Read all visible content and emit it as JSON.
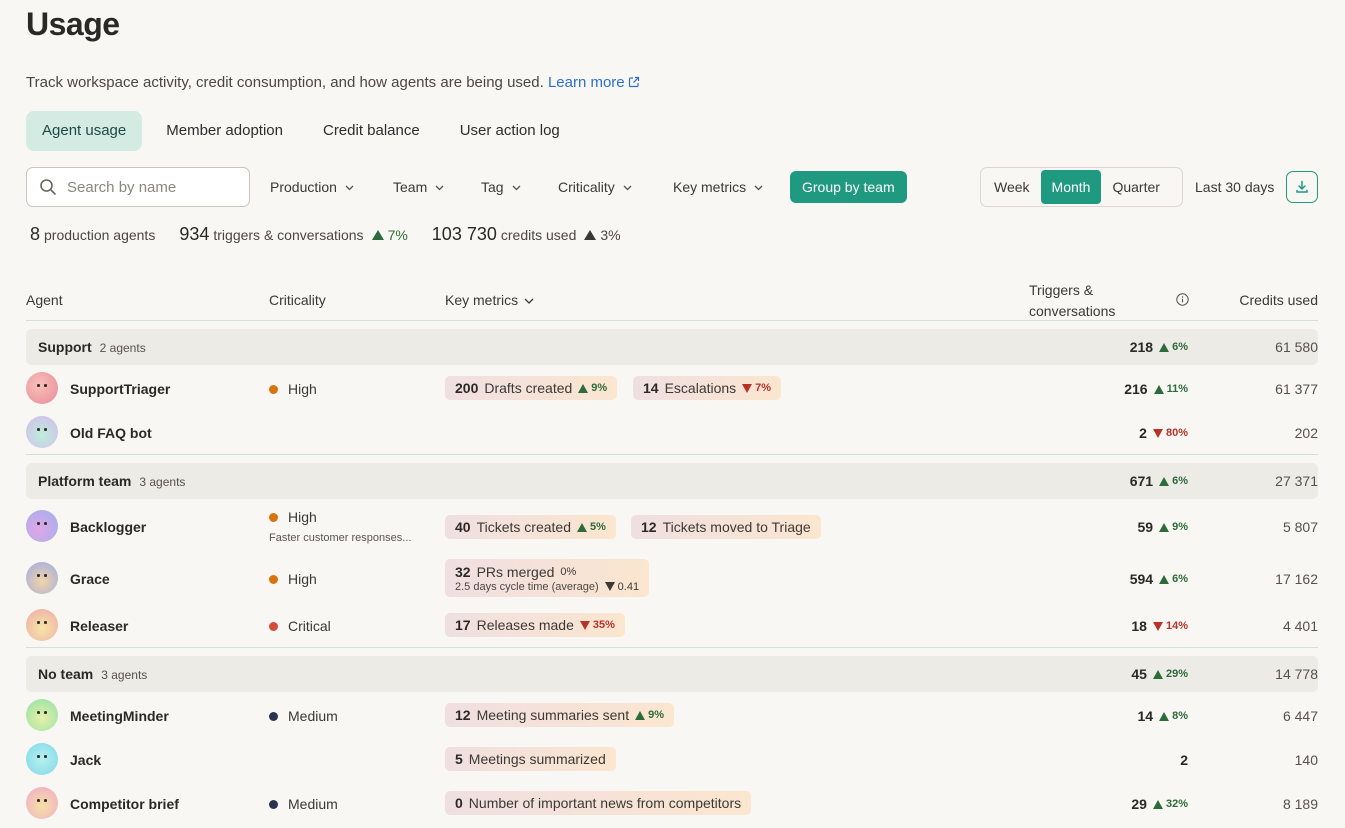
{
  "page": {
    "title": "Usage",
    "subtitle": "Track workspace activity, credit consumption, and how agents are being used.",
    "learn_more": "Learn more"
  },
  "tabs": [
    {
      "label": "Agent usage",
      "active": true
    },
    {
      "label": "Member adoption",
      "active": false
    },
    {
      "label": "Credit balance",
      "active": false
    },
    {
      "label": "User action log",
      "active": false
    }
  ],
  "filters": {
    "search_placeholder": "Search by name",
    "production": "Production",
    "team": "Team",
    "tag": "Tag",
    "criticality": "Criticality",
    "key_metrics": "Key metrics",
    "group_by": "Group by team",
    "periods": [
      "Week",
      "Month",
      "Quarter"
    ],
    "active_period": "Month",
    "range": "Last 30 days"
  },
  "stats": {
    "agents_count": "8",
    "agents_label": "production agents",
    "triggers_count": "934",
    "triggers_label": "triggers & conversations",
    "triggers_change": "7%",
    "credits_count": "103 730",
    "credits_label": "credits used",
    "credits_change": "3%"
  },
  "table": {
    "headers": {
      "agent": "Agent",
      "criticality": "Criticality",
      "key_metrics": "Key metrics",
      "triggers": "Triggers & conversations",
      "credits": "Credits used"
    },
    "groups": [
      {
        "name": "Support",
        "count": "2 agents",
        "triggers": "218",
        "triggers_change": "6%",
        "credits": "61 580",
        "agents": [
          {
            "name": "SupportTriager",
            "criticality": "High",
            "triggers": "216",
            "triggers_change": "11%",
            "triggers_dir": "up",
            "credits": "61 377",
            "metrics": [
              {
                "value": "200",
                "label": "Drafts created",
                "change": "9%",
                "dir": "up"
              },
              {
                "value": "14",
                "label": "Escalations",
                "change": "7%",
                "dir": "down"
              }
            ]
          },
          {
            "name": "Old FAQ bot",
            "criticality": "",
            "triggers": "2",
            "triggers_change": "80%",
            "triggers_dir": "down",
            "credits": "202",
            "metrics": []
          }
        ]
      },
      {
        "name": "Platform team",
        "count": "3 agents",
        "triggers": "671",
        "triggers_change": "6%",
        "credits": "27 371",
        "agents": [
          {
            "name": "Backlogger",
            "criticality": "High",
            "criticality_note": "Faster customer responses...",
            "triggers": "59",
            "triggers_change": "9%",
            "triggers_dir": "up",
            "credits": "5 807",
            "metrics": [
              {
                "value": "40",
                "label": "Tickets created",
                "change": "5%",
                "dir": "up"
              },
              {
                "value": "12",
                "label": "Tickets moved to Triage",
                "change": "",
                "dir": ""
              }
            ]
          },
          {
            "name": "Grace",
            "criticality": "High",
            "triggers": "594",
            "triggers_change": "6%",
            "triggers_dir": "up",
            "credits": "17 162",
            "metrics": [
              {
                "value": "32",
                "label": "PRs merged",
                "change": "0%",
                "dir": "neutral",
                "sub_label": "2.5 days cycle time (average)",
                "sub_change": "0.41"
              }
            ]
          },
          {
            "name": "Releaser",
            "criticality": "Critical",
            "triggers": "18",
            "triggers_change": "14%",
            "triggers_dir": "down",
            "credits": "4 401",
            "metrics": [
              {
                "value": "17",
                "label": "Releases made",
                "change": "35%",
                "dir": "down"
              }
            ]
          }
        ]
      },
      {
        "name": "No team",
        "count": "3 agents",
        "triggers": "45",
        "triggers_change": "29%",
        "credits": "14 778",
        "agents": [
          {
            "name": "MeetingMinder",
            "criticality": "Medium",
            "triggers": "14",
            "triggers_change": "8%",
            "triggers_dir": "up",
            "credits": "6 447",
            "metrics": [
              {
                "value": "12",
                "label": "Meeting summaries sent",
                "change": "9%",
                "dir": "up"
              }
            ]
          },
          {
            "name": "Jack",
            "criticality": "",
            "triggers": "2",
            "triggers_change": "",
            "triggers_dir": "",
            "credits": "140",
            "metrics": [
              {
                "value": "5",
                "label": "Meetings summarized",
                "change": "",
                "dir": ""
              }
            ]
          },
          {
            "name": "Competitor brief",
            "criticality": "Medium",
            "triggers": "29",
            "triggers_change": "32%",
            "triggers_dir": "up",
            "credits": "8 189",
            "metrics": [
              {
                "value": "0",
                "label": "Number of important news from competitors",
                "change": "",
                "dir": ""
              }
            ]
          }
        ]
      }
    ]
  },
  "colors": {
    "accent": "#1f9a80",
    "tab_active_bg": "#d3ebe3",
    "high": "#d9730d",
    "critical": "#d44c3c",
    "medium": "#2b3350",
    "up": "#2e6b3a",
    "down": "#b8322a"
  },
  "icons": [
    "search-icon",
    "chevron-down-icon",
    "external-link-icon",
    "info-icon",
    "download-icon"
  ]
}
